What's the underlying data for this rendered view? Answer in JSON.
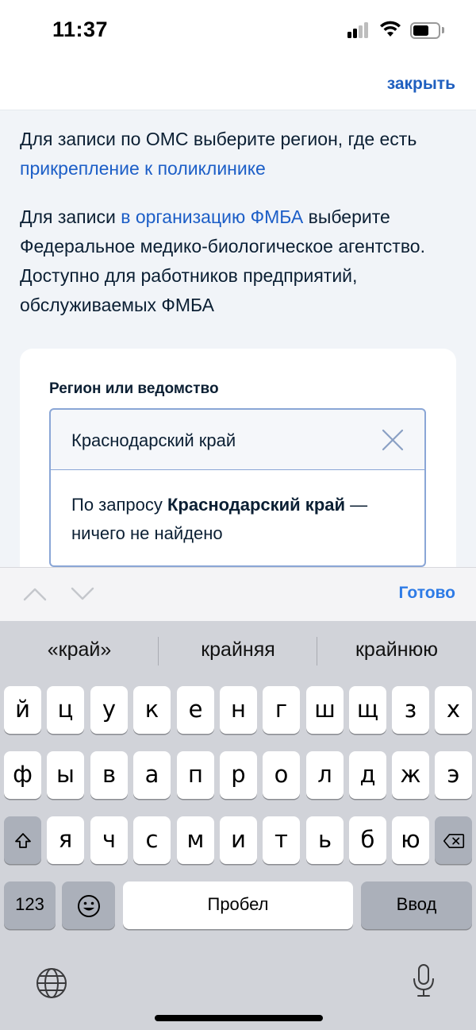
{
  "status_bar": {
    "time": "11:37"
  },
  "header": {
    "close_label": "закрыть"
  },
  "intro": {
    "p1_text": "Для записи по ОМС выберите регион, где есть ",
    "p1_link": "прикрепление к поликлинике",
    "p2_text_before": "Для записи ",
    "p2_link": "в организацию ФМБА",
    "p2_text_after": " выберите Федеральное медико-биологическое агентство. Доступно для работников предприятий, обслуживаемых ФМБА"
  },
  "form": {
    "field_label": "Регион или ведомство",
    "input_value": "Краснодарский край",
    "result_prefix": "По запросу ",
    "result_query": "Краснодарский край",
    "result_suffix": " — ничего не найдено"
  },
  "accessory": {
    "done_label": "Готово"
  },
  "keyboard": {
    "suggestions": [
      "«край»",
      "крайняя",
      "крайнюю"
    ],
    "row1": [
      "й",
      "ц",
      "у",
      "к",
      "е",
      "н",
      "г",
      "ш",
      "щ",
      "з",
      "х"
    ],
    "row2": [
      "ф",
      "ы",
      "в",
      "а",
      "п",
      "р",
      "о",
      "л",
      "д",
      "ж",
      "э"
    ],
    "row3": [
      "я",
      "ч",
      "с",
      "м",
      "и",
      "т",
      "ь",
      "б",
      "ю"
    ],
    "numbers_label": "123",
    "space_label": "Пробел",
    "return_label": "Ввод"
  }
}
